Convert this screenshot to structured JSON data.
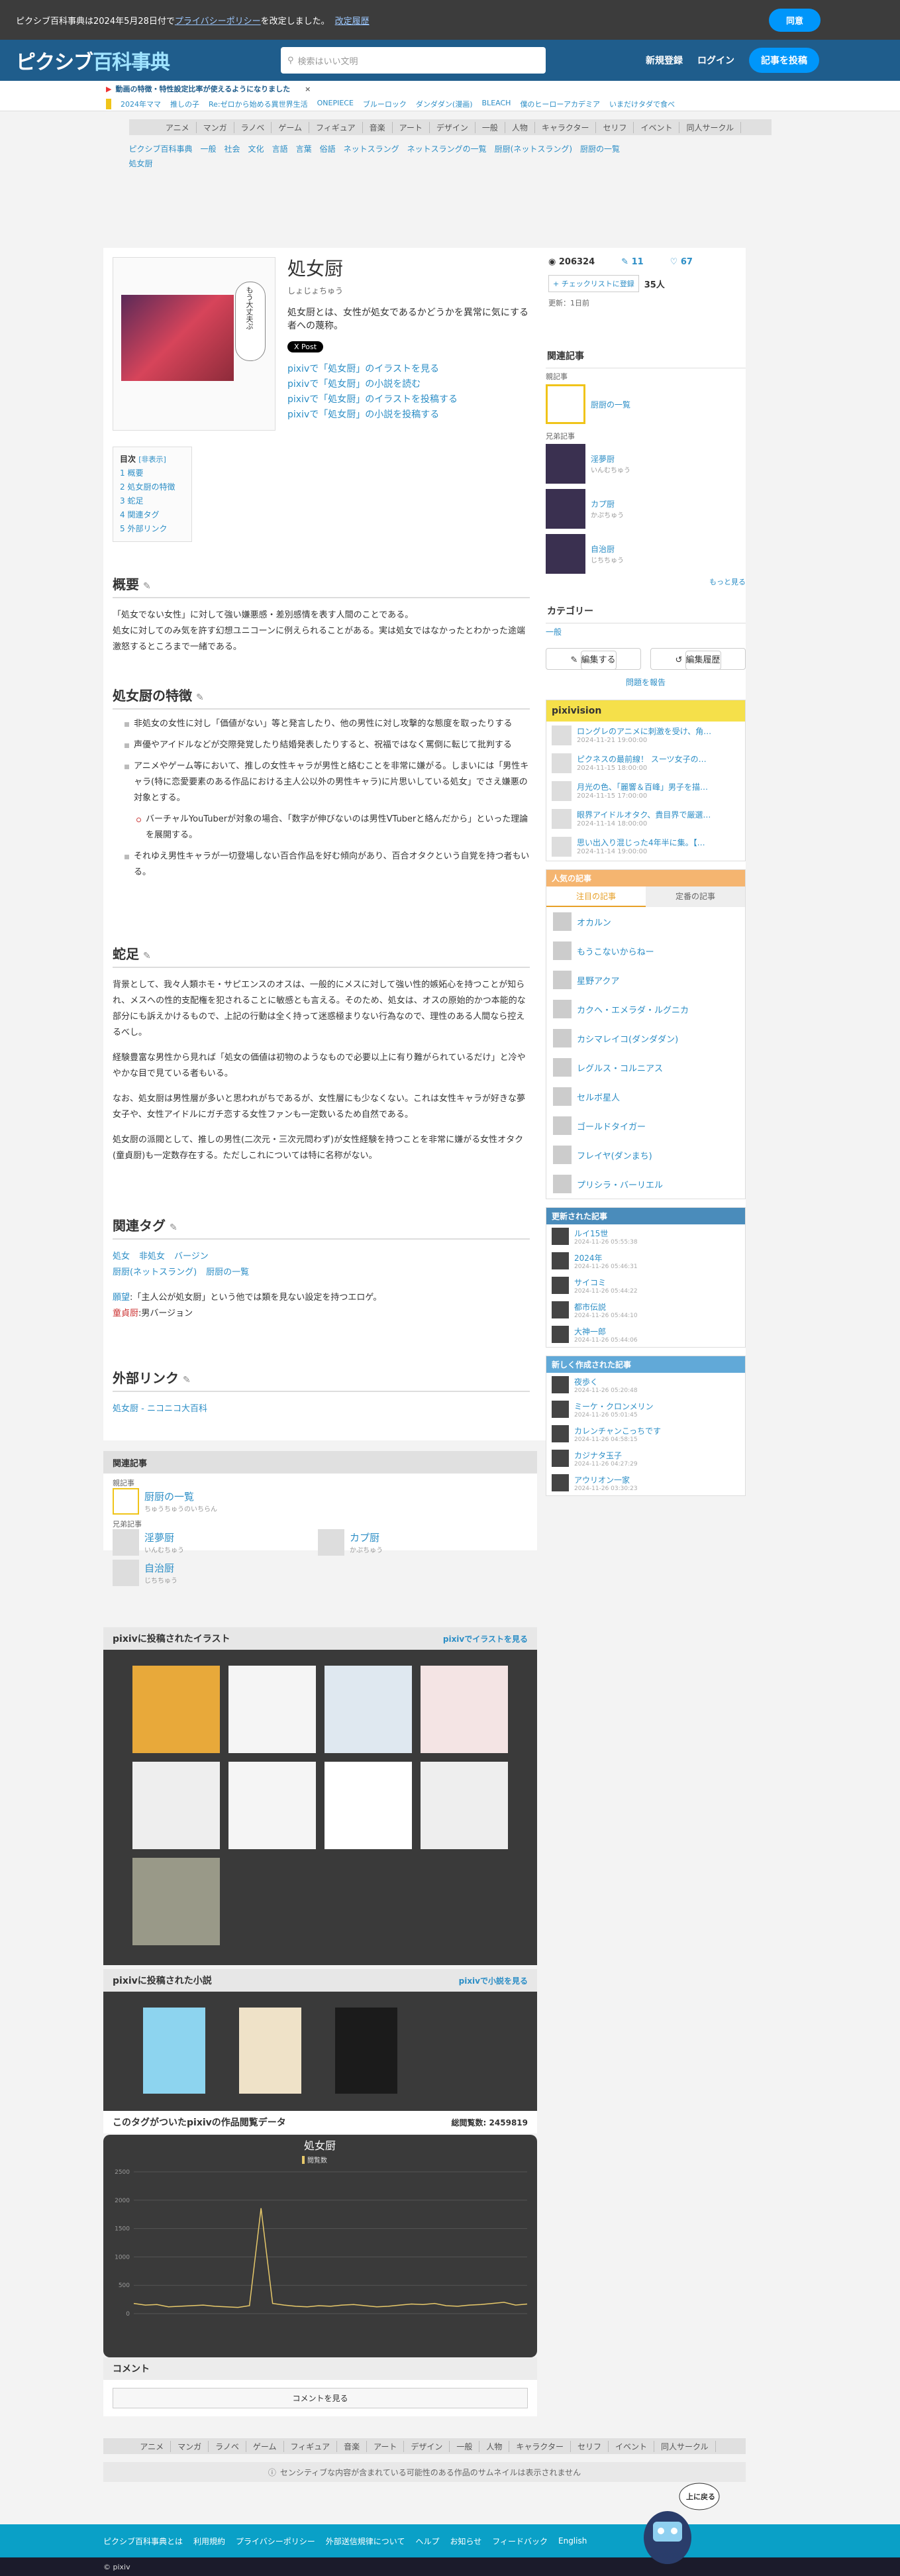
{
  "cookie": {
    "text": "ピクシブ百科事典は2024年5月28日付で",
    "link": "プライバシーポリシー",
    "text2": "を改定しました。",
    "link2": "改定履歴",
    "agree": "同意"
  },
  "header": {
    "logo_a": "ピクシブ",
    "logo_b": "百科事典",
    "search_placeholder": "検索はいい文明",
    "register": "新規登録",
    "login": "ログイン",
    "post": "記事を投稿"
  },
  "notice": {
    "text": "動画の特徴・特性設定比率が使えるようになりました",
    "close": "×"
  },
  "trend": {
    "items": [
      "2024年ママ",
      "推しの子",
      "Re:ゼロから始める異世界生活",
      "ONEPIECE",
      "ブルーロック",
      "ダンダダン(漫画)",
      "BLEACH",
      "僕のヒーローアカデミア",
      "いまだけタダで食べ"
    ]
  },
  "categories": [
    "アニメ",
    "マンガ",
    "ラノベ",
    "ゲーム",
    "フィギュア",
    "音楽",
    "アート",
    "デザイン",
    "一般",
    "人物",
    "キャラクター",
    "セリフ",
    "イベント",
    "同人サークル"
  ],
  "breadcrumbs": [
    "ピクシブ百科事典",
    "一般",
    "社会",
    "文化",
    "言語",
    "言葉",
    "俗語",
    "ネットスラング",
    "ネットスラングの一覧",
    "厨厨(ネットスラング)",
    "厨厨の一覧",
    "処女厨"
  ],
  "article": {
    "title": "処女厨",
    "yomi": "しょじょちゅう",
    "desc": "処女厨とは、女性が処女であるかどうかを異常に気にする者への蔑称。",
    "xpost": "X Post",
    "bubble": "もう大丈夫ぷ",
    "pixiv_links": [
      "pixivで「処女厨」のイラストを見る",
      "pixivで「処女厨」の小説を読む",
      "pixivで「処女厨」のイラストを投稿する",
      "pixivで「処女厨」の小説を投稿する"
    ],
    "toc": {
      "title": "目次",
      "toggle": "[非表示]",
      "items": [
        "1 概要",
        "2 処女厨の特徴",
        "3 蛇足",
        "4 関連タグ",
        "5 外部リンク"
      ]
    },
    "gaiyou": {
      "h": "概要",
      "p1": "「処女でない女性」に対して強い嫌悪感・差別感情を表す人間のことである。",
      "p2": "処女に対してのみ気を許す幻想ユニコーンに例えられることがある。実は処女ではなかったとわかった途端激怒するところまで一緒である。"
    },
    "tokucho": {
      "h": "処女厨の特徴",
      "items": [
        "非処女の女性に対し「価値がない」等と発言したり、他の男性に対し攻撃的な態度を取ったりする",
        "声優やアイドルなどが交際発覚したり結婚発表したりすると、祝福ではなく罵倒に転じて批判する",
        "アニメやゲーム等において、推しの女性キャラが男性と絡むことを非常に嫌がる。しまいには「男性キャラ(特に恋愛要素のある作品における主人公以外の男性キャラ)に片思いしている処女」でさえ嫌悪の対象とする。",
        "バーチャルYouTuberが対象の場合、「数字が伸びないのは男性VTuberと絡んだから」といった理論を展開する。",
        "それゆえ男性キャラが一切登場しない百合作品を好む傾向があり、百合オタクという自覚を持つ者もいる。"
      ]
    },
    "dasoku": {
      "h": "蛇足",
      "p1": "背景として、我々人類ホモ・サピエンスのオスは、一般的にメスに対して強い性的嫉妬心を持つことが知られ、メスへの性的支配権を犯されることに敏感とも言える。そのため、処女は、オスの原始的かつ本能的な部分にも訴えかけるもので、上記の行動は全く持って迷惑極まりない行為なので、理性のある人間なら控えるべし。",
      "p2": "経験豊富な男性から見れば「処女の価値は初物のようなもので必要以上に有り難がられているだけ」と冷ややかな目で見ている者もいる。",
      "p3": "なお、処女厨は男性層が多いと思われがちであるが、女性層にも少なくない。これは女性キャラが好きな夢女子や、女性アイドルにガチ恋する女性ファンも一定数いるため自然である。",
      "p4": "処女厨の派閥として、推しの男性(二次元・三次元問わず)が女性経験を持つことを非常に嫌がる女性オタク(童貞厨)も一定数存在する。ただしこれについては特に名称がない。"
    },
    "tags": {
      "h": "関連タグ",
      "row1": [
        "処女",
        "非処女",
        "バージン"
      ],
      "row2": [
        "厨厨(ネットスラング)",
        "厨厨の一覧"
      ],
      "note1a": "願望",
      "note1b": ":「主人公が処女厨」という他では類を見ない設定を持つエロゲ。",
      "note2a": "童貞厨",
      "note2b": ":男バージョン"
    },
    "ext": {
      "h": "外部リンク",
      "link": "処女厨 - ニコニコ大百科"
    }
  },
  "related": {
    "h": "関連記事",
    "parent": "親記事",
    "parent_item": "厨厨の一覧",
    "parent_yomi": "ちゅうちゅうのいちらん",
    "sib": "兄弟記事",
    "sibs": [
      {
        "t": "淫夢厨",
        "y": "いんむちゅう"
      },
      {
        "t": "カプ厨",
        "y": "かぷちゅう"
      },
      {
        "t": "自治厨",
        "y": "じちちゅう"
      }
    ]
  },
  "gallery": {
    "illust_h": "pixivに投稿されたイラスト",
    "illust_more": "pixivでイラストを見る",
    "novel_h": "pixivに投稿された小説",
    "novel_more": "pixivで小説を見る"
  },
  "views": {
    "h": "このタグがついたpixivの作品閲覧データ",
    "total_label": "総閲覧数:",
    "total": "2459819",
    "title": "処女厨",
    "legend": "閲覧数"
  },
  "chart_data": {
    "type": "line",
    "title": "処女厨",
    "series": [
      {
        "name": "閲覧数",
        "values": [
          180,
          150,
          160,
          120,
          130,
          140,
          150,
          130,
          120,
          110,
          140,
          1860,
          180,
          150,
          130,
          120,
          140,
          130,
          150,
          160,
          140,
          120,
          130,
          150,
          170,
          160,
          180,
          140,
          130,
          150,
          160,
          180,
          200,
          150,
          170
        ]
      }
    ],
    "ylim": [
      0,
      2500
    ],
    "yticks": [
      0,
      500,
      1000,
      1500,
      2000,
      2500
    ]
  },
  "comment": {
    "h": "コメント",
    "btn": "コメントを見る"
  },
  "side": {
    "views": "206324",
    "comments": "11",
    "likes": "67",
    "checklist": "+ チェックリストに登録",
    "users": "35人",
    "updated": "更新：1日前",
    "rel_h": "関連記事",
    "parent": "親記事",
    "parent_item": "厨厨の一覧",
    "sib": "兄弟記事",
    "sibs": [
      {
        "t": "淫夢厨",
        "y": "いんむちゅう"
      },
      {
        "t": "カプ厨",
        "y": "かぷちゅう"
      },
      {
        "t": "自治厨",
        "y": "じちちゅう"
      }
    ],
    "more": "もっと見る",
    "cat_h": "カテゴリー",
    "cat": "一般",
    "edit": "編集する",
    "history": "編集履歴",
    "report": "問題を報告"
  },
  "pixivision": {
    "h": "pixivision",
    "items": [
      {
        "t": "ロングレのアニメに刺激を受け、角…",
        "d": "2024-11-21 19:00:00"
      },
      {
        "t": "ピクネスの最前線！ スーツ女子の…",
        "d": "2024-11-15 18:00:00"
      },
      {
        "t": "月光の色、「麗響＆百峰」男子を描…",
        "d": "2024-11-15 17:00:00"
      },
      {
        "t": "眼界アイドルオタク、貴目界で厳選…",
        "d": "2024-11-14 18:00:00"
      },
      {
        "t": "思い出入り混じった4年半に集。【…",
        "d": "2024-11-14 19:00:00"
      }
    ]
  },
  "popular": {
    "h": "人気の記事",
    "tab1": "注目の記事",
    "tab2": "定番の記事",
    "items": [
      "オカルン",
      "もうこないからねー",
      "星野アクア",
      "カクヘ・エメラダ・ルグニカ",
      "カシマレイコ(ダンダダン)",
      "レグルス・コルニアス",
      "セルボ星人",
      "ゴールドタイガー",
      "フレイヤ(ダンまち)",
      "プリシラ・バーリエル"
    ]
  },
  "updated": {
    "h": "更新された記事",
    "items": [
      {
        "t": "ルイ15世",
        "d": "2024-11-26 05:55:38"
      },
      {
        "t": "2024年",
        "d": "2024-11-26 05:46:31"
      },
      {
        "t": "サイコミ",
        "d": "2024-11-26 05:44:22"
      },
      {
        "t": "都市伝説",
        "d": "2024-11-26 05:44:10"
      },
      {
        "t": "大神一郎",
        "d": "2024-11-26 05:44:06"
      }
    ]
  },
  "newart": {
    "h": "新しく作成された記事",
    "items": [
      {
        "t": "夜歩く",
        "d": "2024-11-26 05:20:48"
      },
      {
        "t": "ミーケ・クロンメリン",
        "d": "2024-11-26 05:01:45"
      },
      {
        "t": "カレンチャンこっちです",
        "d": "2024-11-26 04:58:15"
      },
      {
        "t": "カジナタ玉子",
        "d": "2024-11-26 04:27:29"
      },
      {
        "t": "アウリオン一家",
        "d": "2024-11-26 03:30:23"
      }
    ]
  },
  "sensitive": "センシティブな内容が含まれている可能性のある作品のサムネイルは表示されません",
  "footer": {
    "links": [
      "ピクシブ百科事典とは",
      "利用規約",
      "プライバシーポリシー",
      "外部送信規律について",
      "ヘルプ",
      "お知らせ",
      "フィードバック",
      "English"
    ],
    "copy": "© pixiv",
    "totop": "上に戻る"
  }
}
